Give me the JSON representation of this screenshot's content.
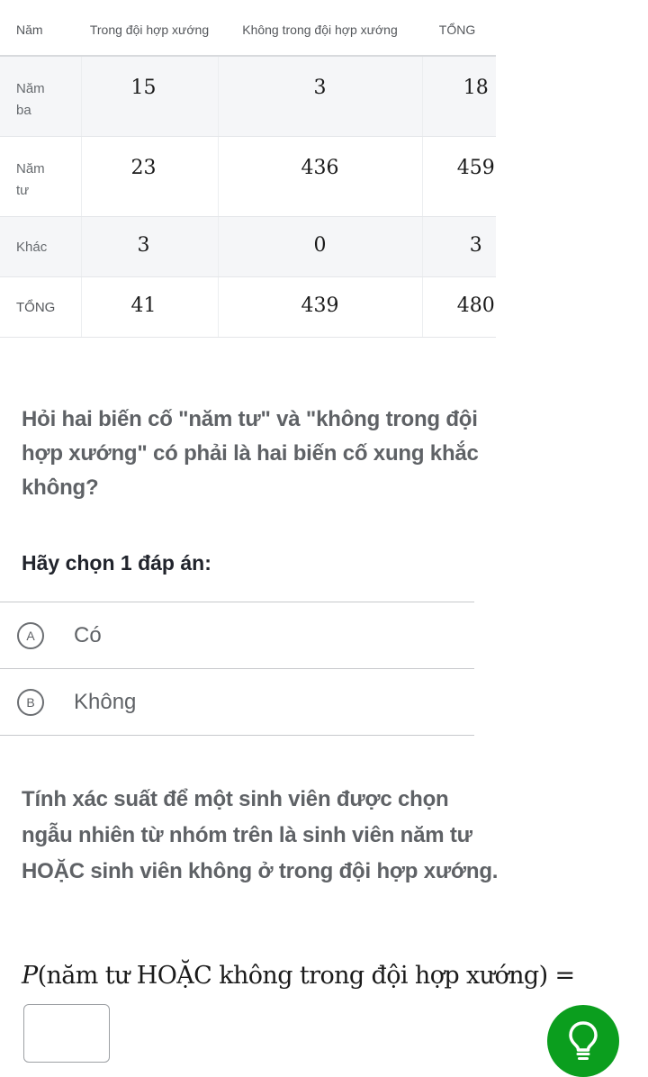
{
  "table": {
    "headers": [
      "Năm",
      "Trong đội hợp xướng",
      "Không trong đội hợp xướng",
      "TỔNG"
    ],
    "rows": [
      {
        "label": "Năm ba",
        "values": [
          "15",
          "3",
          "18"
        ]
      },
      {
        "label": "Năm tư",
        "values": [
          "23",
          "436",
          "459"
        ]
      },
      {
        "label": "Khác",
        "values": [
          "3",
          "0",
          "3"
        ]
      },
      {
        "label": "TỔNG",
        "values": [
          "41",
          "439",
          "480"
        ]
      }
    ]
  },
  "question1": {
    "text": "Hỏi hai biến cố \"năm tư\" và \"không trong đội hợp xướng\" có phải là hai biến cố xung khắc không?",
    "prompt": "Hãy chọn 1 đáp án:",
    "choices": [
      {
        "letter": "A",
        "text": "Có"
      },
      {
        "letter": "B",
        "text": "Không"
      }
    ]
  },
  "question2": {
    "text": "Tính xác suất để một sinh viên được chọn ngẫu nhiên từ nhóm trên là sinh viên năm tư HOẶC sinh viên không ở trong đội hợp xướng.",
    "formula_p": "P",
    "formula_body": "(năm tư HOẶC không trong đội hợp xướng) =",
    "answer_value": ""
  },
  "hint": {
    "icon": "lightbulb-icon",
    "color": "#0b9e1e"
  }
}
